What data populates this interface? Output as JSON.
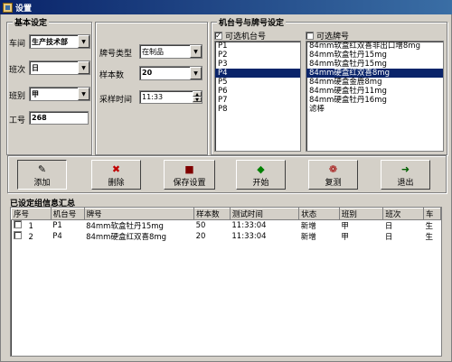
{
  "window": {
    "title": "设置",
    "icon": "settings-app-icon"
  },
  "basic": {
    "title": "基本设定",
    "workshop_label": "车间",
    "workshop_value": "生产技术部",
    "shift_label": "班次",
    "shift_value": "日",
    "team_label": "班别",
    "team_value": "甲",
    "empid_label": "工号",
    "empid_value": "268"
  },
  "brand_settings": {
    "brand_type_label": "牌号类型",
    "brand_type_value": "在制品",
    "sample_count_label": "样本数",
    "sample_count_value": "20",
    "sample_time_label": "采样时间",
    "sample_time_value": "11:33"
  },
  "machine": {
    "title": "机台号与牌号设定",
    "machines_header": "可选机台号",
    "machines_checked": true,
    "machines": [
      "P1",
      "P2",
      "P3",
      "P4",
      "P5",
      "P6",
      "P7",
      "P8"
    ],
    "machines_selected": "P4",
    "brands_header": "可选牌号",
    "brands_checked": false,
    "brands": [
      "84mm软盒红双喜非出口增8mg",
      "84mm软盒牡丹15mg",
      "84mm软盒牡丹15mg",
      "84mm硬盒红双喜8mg",
      "84mm硬盒金鹿8mg",
      "84mm硬盒牡丹11mg",
      "84mm硬盒牡丹16mg",
      "滤棒"
    ],
    "brands_selected": "84mm硬盒红双喜8mg"
  },
  "toolbar": {
    "add": "添加",
    "delete": "删除",
    "save": "保存设置",
    "start": "开始",
    "recheck": "复测",
    "exit": "退出"
  },
  "summary": {
    "title": "已设定组信息汇总",
    "columns": [
      "序号",
      "机台号",
      "牌号",
      "样本数",
      "测试时间",
      "状态",
      "班别",
      "班次",
      "车"
    ],
    "rows": [
      {
        "no": "1",
        "machine": "P1",
        "brand": "84mm软盒牡丹15mg",
        "samples": "50",
        "time": "11:33:04",
        "status": "新增",
        "team": "甲",
        "shift": "日",
        "workshop": "生"
      },
      {
        "no": "2",
        "machine": "P4",
        "brand": "84mm硬盒红双喜8mg",
        "samples": "20",
        "time": "11:33:04",
        "status": "新增",
        "team": "甲",
        "shift": "日",
        "workshop": "生"
      }
    ]
  }
}
